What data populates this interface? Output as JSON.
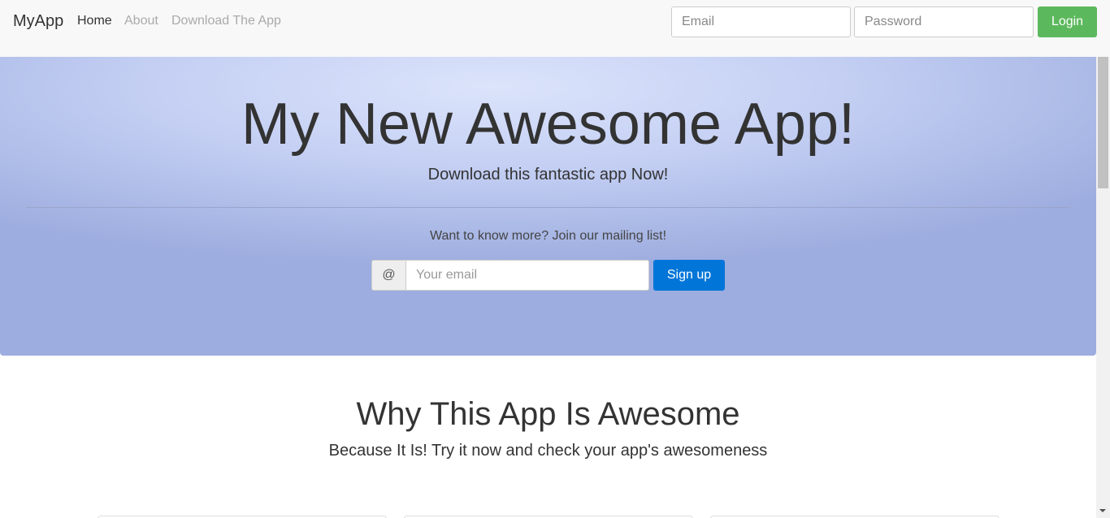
{
  "navbar": {
    "brand": "MyApp",
    "links": [
      {
        "label": "Home",
        "active": true
      },
      {
        "label": "About",
        "active": false
      },
      {
        "label": "Download The App",
        "active": false
      }
    ],
    "email_placeholder": "Email",
    "password_placeholder": "Password",
    "login_label": "Login"
  },
  "hero": {
    "title": "My New Awesome App!",
    "subtitle": "Download this fantastic app Now!",
    "mailing_text": "Want to know more? Join our mailing list!",
    "addon": "@",
    "email_placeholder": "Your email",
    "signup_label": "Sign up"
  },
  "why": {
    "title": "Why This App Is Awesome",
    "subtitle": "Because It Is! Try it now and check your app's awesomeness"
  },
  "colors": {
    "login_button": "#5cb85c",
    "signup_button": "#0275d8",
    "hero_background": "#b7c4ee"
  }
}
